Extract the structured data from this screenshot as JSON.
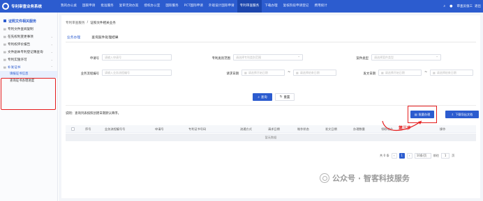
{
  "app": {
    "title": "专利审查业务系统"
  },
  "nav": {
    "tabs": [
      "我的办公桌",
      "国家申请",
      "批准服务",
      "复审无效办案",
      "授权办公室",
      "国际服务",
      "PCT国际申请",
      "外观设计国际申请",
      "专利审查服务",
      "下载办理",
      "复核阶段申请登记",
      "费用统计"
    ],
    "active_index": 8,
    "user": "审查员张三",
    "logout": "退出"
  },
  "sidebar": {
    "title": "证照文件相关服务",
    "items": [
      {
        "label": "专利文件查阅复制",
        "expandable": false
      },
      {
        "label": "在先权利变更事项",
        "expandable": true
      },
      {
        "label": "专利权评价报告",
        "expandable": true
      },
      {
        "label": "文件副本专利登记簿查询",
        "expandable": true
      },
      {
        "label": "专利实施许可",
        "expandable": true
      },
      {
        "label": "补发证书",
        "expandable": true
      }
    ],
    "subitems": [
      "填报证书信息",
      "查询证书办理进度"
    ]
  },
  "breadcrumb": [
    "专利审查服务",
    "证照文件相关业务"
  ],
  "tabs": [
    "业务办理",
    "查询案件处理结果"
  ],
  "form": {
    "app_no": {
      "label": "申请号",
      "placeholder": "请输入申请号"
    },
    "category": {
      "label": "专利类别范围",
      "placeholder": "请选择专利类别范围"
    },
    "app_type": {
      "label": "案件类型",
      "placeholder": "请选择案件类型"
    },
    "serial": {
      "label": "业务流程编号",
      "placeholder": "请输入业务流程编号"
    },
    "req_date": {
      "label": "请求日期",
      "start": "请选择开始日期",
      "end": "请选择结束日期"
    },
    "send_date": {
      "label": "发文日期",
      "start": "请选择开始日期",
      "end": "请选择结束日期"
    },
    "search": "查询",
    "reset": "重置"
  },
  "toolbar": {
    "note": "说明：查询列表按照创建日期默认降序。",
    "batch": "批量办理",
    "download": "下载导出文档"
  },
  "table": {
    "headers": [
      "序号",
      "业务流程编号号",
      "申请号",
      "专利证书号码",
      "流通方式",
      "请求日期",
      "制作状态",
      "发文日期",
      "办理数量",
      "领取地点",
      "操作"
    ],
    "empty": "暂无数据"
  },
  "annotation": "第三步",
  "pager": {
    "total": "共 0 条",
    "current": "1",
    "size": "10条/页",
    "goto": "前往",
    "page_value": "1",
    "unit": "页"
  },
  "watermark": "公众号 · 智客科技服务"
}
